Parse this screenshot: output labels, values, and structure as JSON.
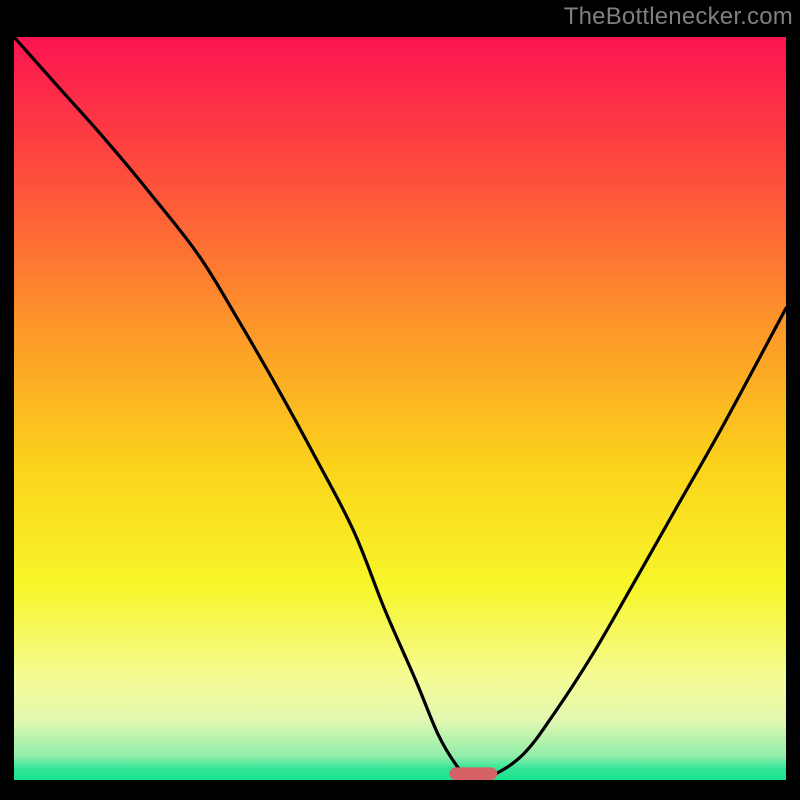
{
  "watermark": "TheBottlenecker.com",
  "colors": {
    "frame": "#000000",
    "curve": "#000000",
    "marker": "#d66166",
    "gradient_stops": [
      {
        "offset": 0.0,
        "color": "#fc1451"
      },
      {
        "offset": 0.18,
        "color": "#fd4b3c"
      },
      {
        "offset": 0.38,
        "color": "#fd932a"
      },
      {
        "offset": 0.58,
        "color": "#fbd41b"
      },
      {
        "offset": 0.74,
        "color": "#f7f629"
      },
      {
        "offset": 0.86,
        "color": "#f5fb93"
      },
      {
        "offset": 0.92,
        "color": "#e2f8b1"
      },
      {
        "offset": 0.968,
        "color": "#8eeeaa"
      },
      {
        "offset": 0.985,
        "color": "#32e597"
      },
      {
        "offset": 1.0,
        "color": "#18e390"
      }
    ]
  },
  "chart_data": {
    "type": "line",
    "title": "",
    "xlabel": "",
    "ylabel": "",
    "xlim": [
      0,
      100
    ],
    "ylim": [
      0,
      100
    ],
    "x": [
      0,
      6,
      12,
      18,
      24,
      29,
      34,
      39,
      44,
      48,
      52,
      55,
      57.5,
      59,
      60,
      62,
      66,
      70,
      75,
      80,
      86,
      92,
      100
    ],
    "values": [
      100,
      93,
      86,
      78.5,
      70.5,
      62,
      53,
      43.5,
      33.5,
      23,
      13.5,
      6,
      1.7,
      0.3,
      0.2,
      0.6,
      3.5,
      9,
      17,
      26,
      37,
      48,
      63.5
    ],
    "marker": {
      "x": 59.5,
      "y": 0.0,
      "rx": 3.1,
      "ry": 0.85
    },
    "notes": "y is percent of vertical extent from bottom (0) to top (100); curve is a V-shaped bottleneck plot with minimum near x≈59-60."
  }
}
